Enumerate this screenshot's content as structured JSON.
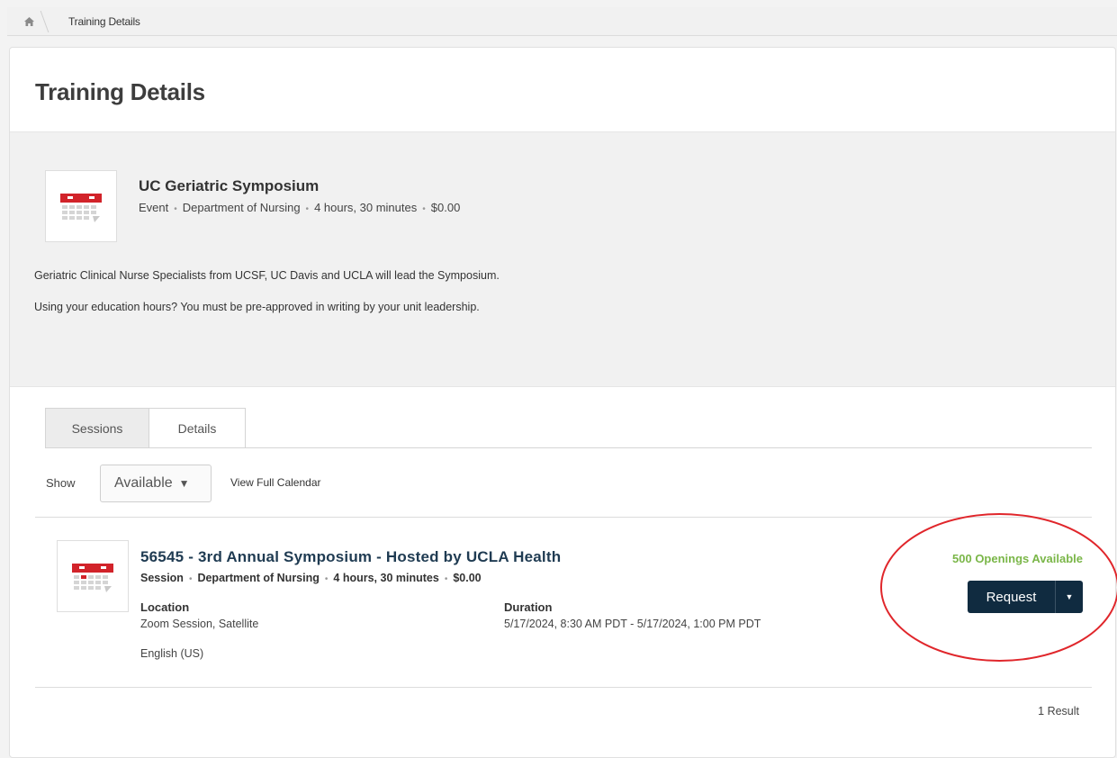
{
  "breadcrumb": {
    "current": "Training Details"
  },
  "page": {
    "title": "Training Details"
  },
  "event": {
    "title": "UC Geriatric Symposium",
    "meta": [
      "Event",
      "Department of Nursing",
      "4 hours, 30 minutes",
      "$0.00"
    ],
    "description_1": "Geriatric Clinical Nurse Specialists from UCSF, UC Davis and UCLA will lead the Symposium.",
    "description_2": "Using your education hours? You must be pre-approved in writing by your unit leadership."
  },
  "tabs": [
    {
      "label": "Sessions",
      "active": true
    },
    {
      "label": "Details",
      "active": false
    }
  ],
  "filter": {
    "show_label": "Show",
    "selected": "Available",
    "calendar_link": "View Full Calendar"
  },
  "session": {
    "title": "56545 - 3rd Annual Symposium - Hosted by UCLA Health",
    "meta": [
      "Session",
      "Department of Nursing",
      "4 hours, 30 minutes",
      "$0.00"
    ],
    "location_label": "Location",
    "location_value": "Zoom Session, Satellite",
    "language": "English (US)",
    "duration_label": "Duration",
    "duration_value": "5/17/2024, 8:30 AM PDT - 5/17/2024, 1:00 PM PDT",
    "openings": "500 Openings Available",
    "request_label": "Request"
  },
  "results": "1 Result",
  "colors": {
    "accent_dark": "#102b40",
    "openings_green": "#7ab648",
    "annotation_red": "#e0262b",
    "calendar_red": "#d2232a"
  },
  "icons": {
    "home": "home-icon",
    "calendar": "calendar-icon",
    "dropdown": "caret-down-icon"
  }
}
